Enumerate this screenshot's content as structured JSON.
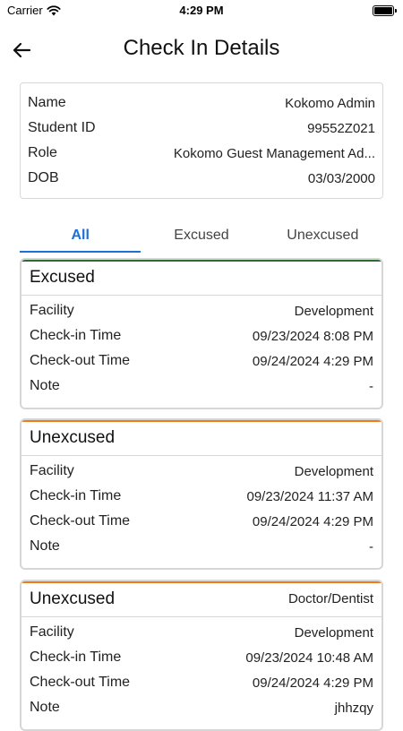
{
  "status_bar": {
    "carrier": "Carrier",
    "time": "4:29 PM"
  },
  "header": {
    "title": "Check In Details",
    "back_icon": "arrow-left-icon"
  },
  "profile": {
    "rows": [
      {
        "label": "Name",
        "value": "Kokomo Admin"
      },
      {
        "label": "Student ID",
        "value": "99552Z021"
      },
      {
        "label": "Role",
        "value": "Kokomo Guest Management Ad..."
      },
      {
        "label": "DOB",
        "value": "03/03/2000"
      }
    ]
  },
  "tabs": [
    {
      "label": "All",
      "active": true
    },
    {
      "label": "Excused",
      "active": false
    },
    {
      "label": "Unexcused",
      "active": false
    }
  ],
  "colors": {
    "accent": "#1f6fd6",
    "excused": "#2e6b2e",
    "unexcused": "#f07a1a"
  },
  "records": [
    {
      "status": "Excused",
      "reason": "",
      "rows": [
        {
          "label": "Facility",
          "value": "Development"
        },
        {
          "label": "Check-in Time",
          "value": "09/23/2024 8:08 PM"
        },
        {
          "label": "Check-out Time",
          "value": "09/24/2024 4:29 PM"
        },
        {
          "label": "Note",
          "value": "-"
        }
      ]
    },
    {
      "status": "Unexcused",
      "reason": "",
      "rows": [
        {
          "label": "Facility",
          "value": "Development"
        },
        {
          "label": "Check-in Time",
          "value": "09/23/2024 11:37 AM"
        },
        {
          "label": "Check-out Time",
          "value": "09/24/2024 4:29 PM"
        },
        {
          "label": "Note",
          "value": "-"
        }
      ]
    },
    {
      "status": "Unexcused",
      "reason": "Doctor/Dentist",
      "rows": [
        {
          "label": "Facility",
          "value": "Development"
        },
        {
          "label": "Check-in Time",
          "value": "09/23/2024 10:48 AM"
        },
        {
          "label": "Check-out Time",
          "value": "09/24/2024 4:29 PM"
        },
        {
          "label": "Note",
          "value": "jhhzqy"
        }
      ]
    }
  ]
}
